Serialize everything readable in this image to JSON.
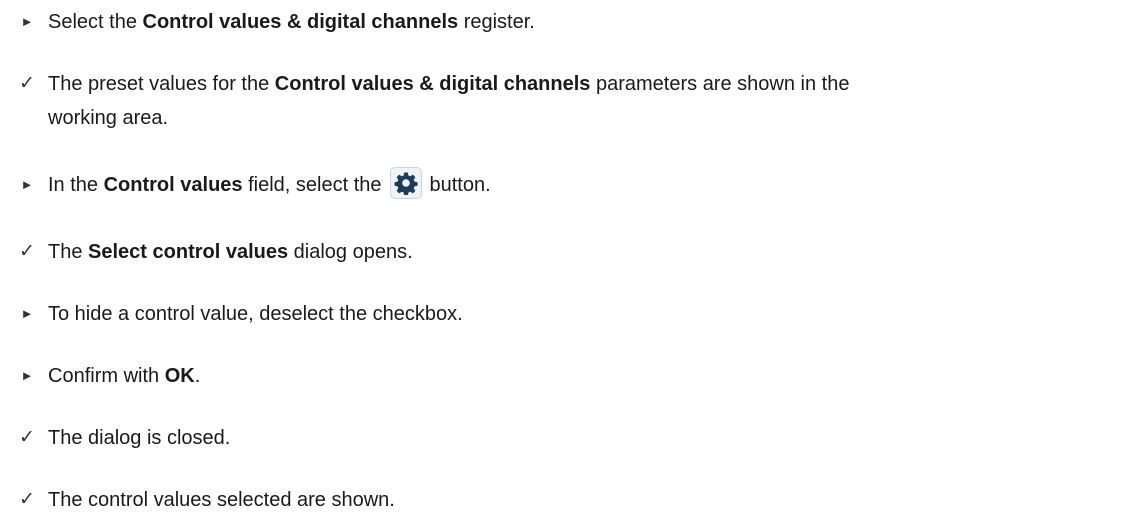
{
  "markers": {
    "action": "►",
    "result": "✓"
  },
  "steps": [
    {
      "type": "action",
      "before": "Select the ",
      "bold": "Control values & digital channels",
      "after": " register."
    },
    {
      "type": "result",
      "before": "The preset values for the ",
      "bold": "Control values & digital channels",
      "after": " parameters are shown in the",
      "line2": "working area."
    },
    {
      "type": "action",
      "before": "In the ",
      "bold": "Control values",
      "after": " field, select the",
      "icon": "gear-icon",
      "after_icon": "button."
    },
    {
      "type": "result",
      "before": "The ",
      "bold": "Select control values",
      "after": " dialog opens."
    },
    {
      "type": "action",
      "text": "To hide a control value, deselect the checkbox."
    },
    {
      "type": "action",
      "before": "Confirm with ",
      "bold": "OK",
      "after": "."
    },
    {
      "type": "result",
      "text": "The dialog is closed."
    },
    {
      "type": "result",
      "text": "The control values selected are shown."
    }
  ],
  "colors": {
    "text": "#1a1a1a",
    "gear": "#1f3b5c",
    "button_bg": "#eef3f8",
    "button_border": "#c9d6e2"
  }
}
